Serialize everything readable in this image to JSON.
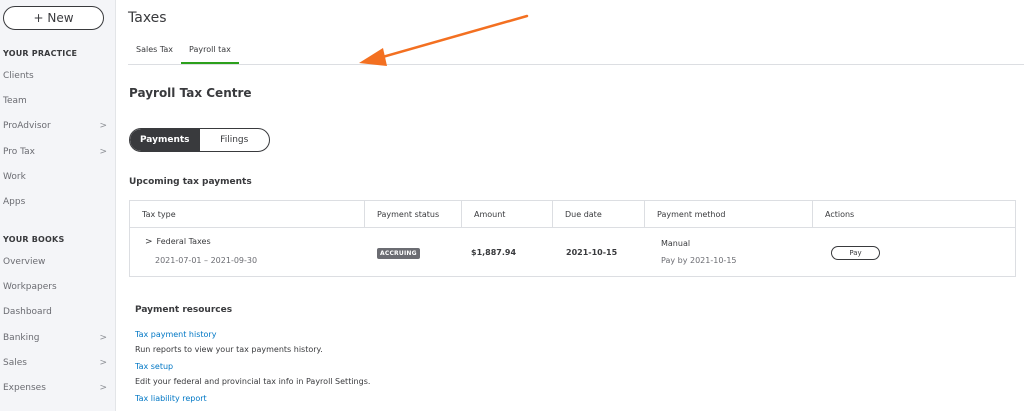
{
  "sidebar": {
    "new_label": "+ New",
    "practice_heading": "YOUR PRACTICE",
    "practice_items": [
      {
        "label": "Clients",
        "chevron": false
      },
      {
        "label": "Team",
        "chevron": false
      },
      {
        "label": "ProAdvisor",
        "chevron": true
      },
      {
        "label": "Pro Tax",
        "chevron": true
      },
      {
        "label": "Work",
        "chevron": false
      },
      {
        "label": "Apps",
        "chevron": false
      }
    ],
    "books_heading": "YOUR BOOKS",
    "books_items": [
      {
        "label": "Overview",
        "chevron": false
      },
      {
        "label": "Workpapers",
        "chevron": false
      },
      {
        "label": "Dashboard",
        "chevron": false
      },
      {
        "label": "Banking",
        "chevron": true
      },
      {
        "label": "Sales",
        "chevron": true
      },
      {
        "label": "Expenses",
        "chevron": true
      }
    ],
    "chevron_glyph": ">"
  },
  "header": {
    "title": "Taxes",
    "tabs": [
      {
        "label": "Sales Tax",
        "active": false
      },
      {
        "label": "Payroll tax",
        "active": true
      }
    ]
  },
  "main": {
    "centre_title": "Payroll Tax Centre",
    "toggle": {
      "payments": "Payments",
      "filings": "Filings"
    },
    "upcoming_title": "Upcoming tax payments",
    "columns": [
      "Tax type",
      "Payment status",
      "Amount",
      "Due date",
      "Payment method",
      "Actions"
    ],
    "row": {
      "caret": ">",
      "tax_type": "Federal Taxes",
      "period": "2021-07-01 – 2021-09-30",
      "status": "ACCRUING",
      "amount": "$1,887.94",
      "due_date": "2021-10-15",
      "method": "Manual",
      "method_sub": "Pay by 2021-10-15",
      "action": "Pay"
    },
    "resources": {
      "title": "Payment resources",
      "links": [
        {
          "label": "Tax payment history",
          "desc": "Run reports to view your tax payments history."
        },
        {
          "label": "Tax setup",
          "desc": "Edit your federal and provincial tax info in Payroll Settings."
        },
        {
          "label": "Tax liability report",
          "desc": ""
        }
      ]
    }
  },
  "colors": {
    "accent_green": "#2ca01c",
    "link_blue": "#0077c5",
    "arrow_orange": "#f37021"
  }
}
